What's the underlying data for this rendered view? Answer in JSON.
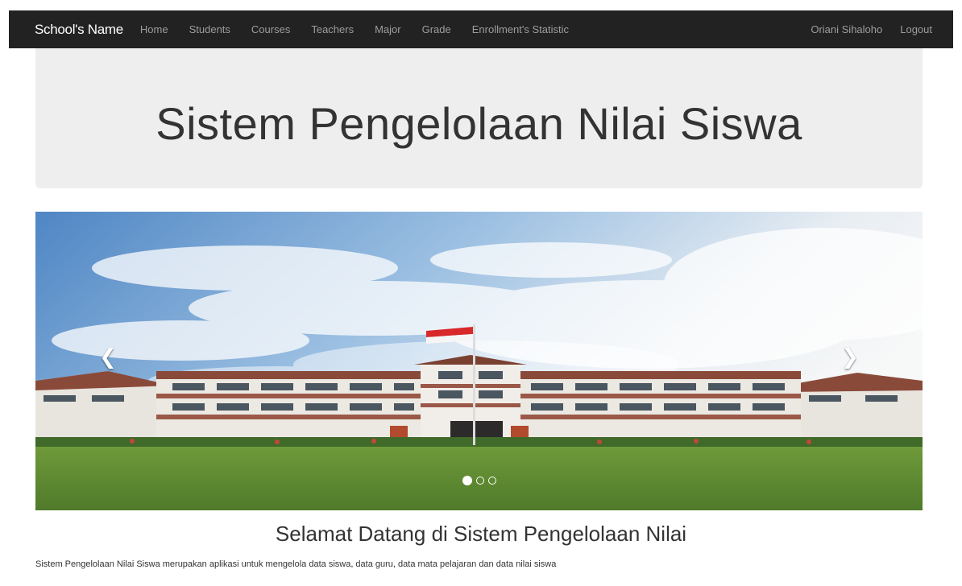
{
  "navbar": {
    "brand": "School's Name",
    "left_items": [
      "Home",
      "Students",
      "Courses",
      "Teachers",
      "Major",
      "Grade",
      "Enrollment's Statistic"
    ],
    "right_items": [
      "Oriani Sihaloho",
      "Logout"
    ],
    "background": "#222222"
  },
  "jumbotron": {
    "title": "Sistem Pengelolaan Nilai Siswa",
    "background": "#eeeeee"
  },
  "carousel": {
    "prev_icon": "chevron-left-icon",
    "next_icon": "chevron-right-icon",
    "slide_count": 3,
    "active_slide": 1
  },
  "welcome": {
    "heading": "Selamat Datang di Sistem Pengelolaan Nilai",
    "description": "Sistem Pengelolaan Nilai Siswa merupakan aplikasi untuk mengelola data siswa, data guru, data mata pelajaran dan data nilai siswa"
  }
}
